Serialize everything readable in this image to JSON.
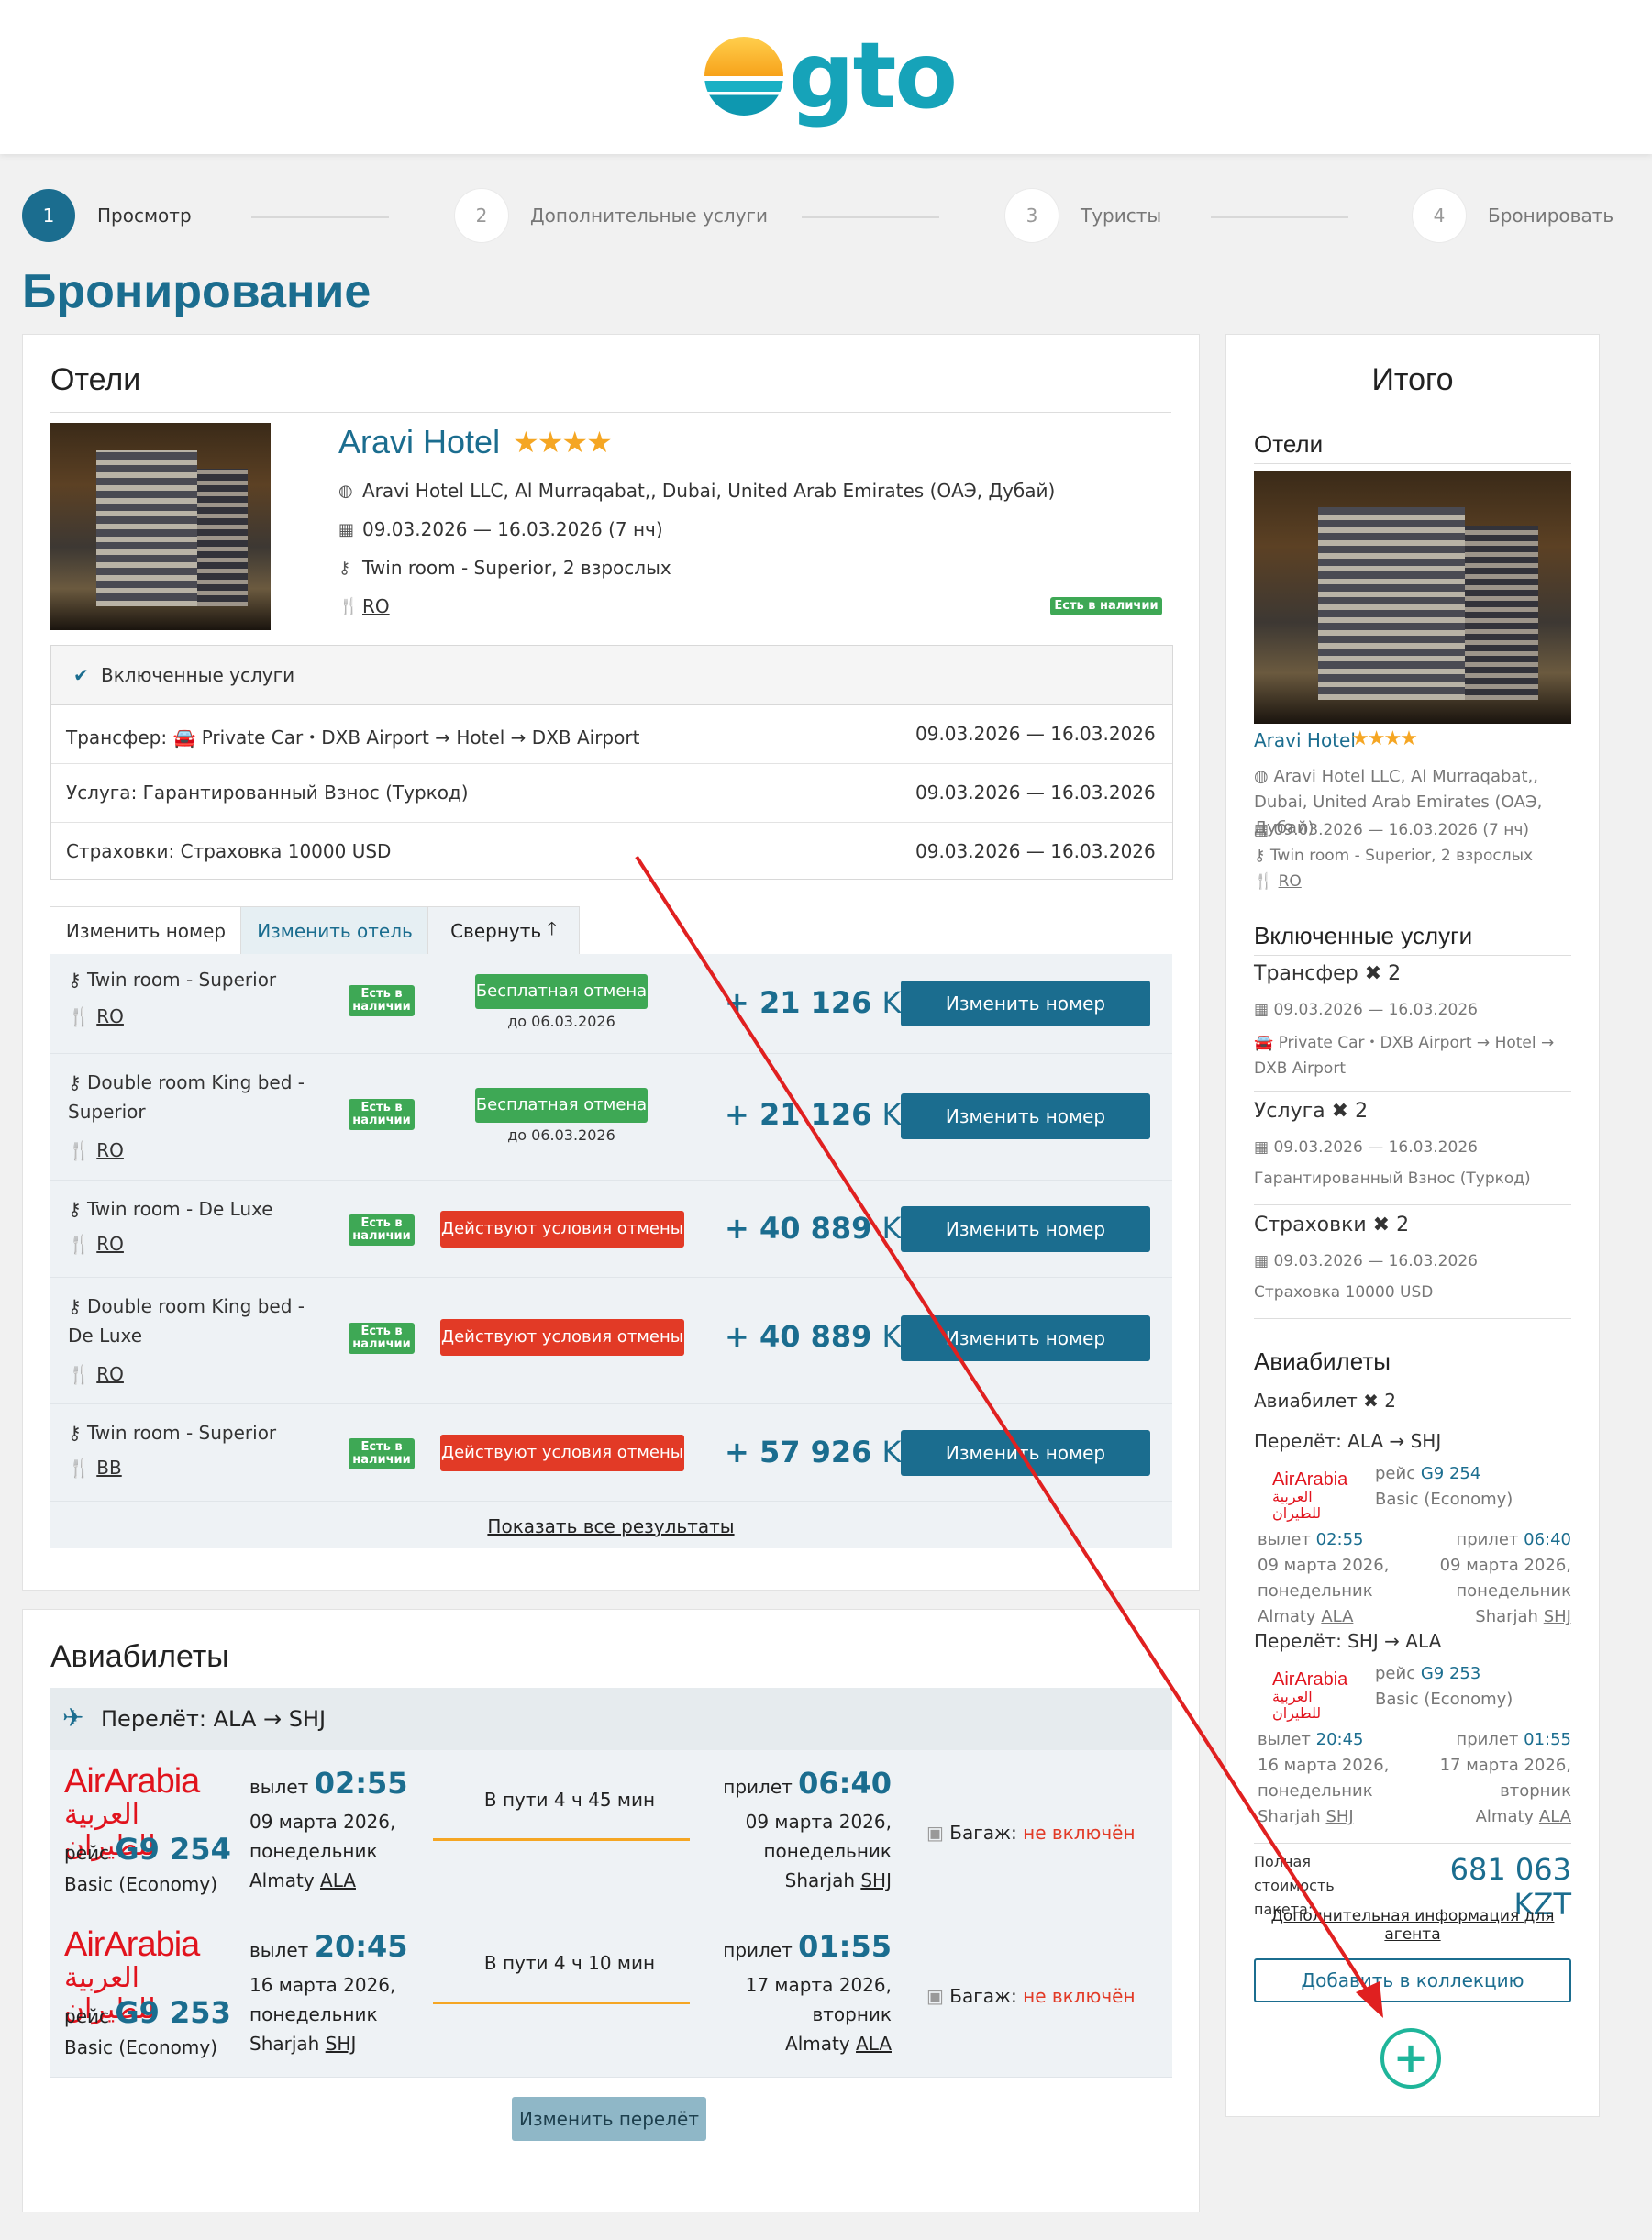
{
  "brand": {
    "logo_text": "gto"
  },
  "steps": [
    {
      "num": "1",
      "label": "Просмотр"
    },
    {
      "num": "2",
      "label": "Дополнительные услуги"
    },
    {
      "num": "3",
      "label": "Туристы"
    },
    {
      "num": "4",
      "label": "Бронировать"
    }
  ],
  "page_title": "Бронирование",
  "hotels": {
    "section_title": "Отели",
    "hotel_name": "Aravi Hotel",
    "stars": "★★★★",
    "address": "Aravi Hotel LLC, Al Murraqabat,, Dubai, United Arab Emirates (ОАЭ, Дубай)",
    "dates": "09.03.2026 —  16.03.2026 (7 нч)",
    "room": "Twin room - Superior, 2 взрослых",
    "board": "RO",
    "availability": "Есть в наличии",
    "included": {
      "title": "Включенные услуги",
      "rows": [
        {
          "label": "Трансфер:",
          "detail": "Private Car・DXB Airport → Hotel → DXB Airport",
          "dates": "09.03.2026 —  16.03.2026"
        },
        {
          "label": "Услуга:",
          "detail": "Гарантированный Взнос (Туркод)",
          "dates": "09.03.2026 —  16.03.2026"
        },
        {
          "label": "Страховки:",
          "detail": "Страховка 10000 USD",
          "dates": "09.03.2026 —  16.03.2026"
        }
      ]
    },
    "tabs": {
      "change_room": "Изменить номер",
      "change_hotel": "Изменить отель",
      "collapse": "Свернуть"
    },
    "rooms": [
      {
        "name": "Twin room - Superior",
        "board": "RO",
        "avail": "Есть в наличии",
        "policy": "Бесплатная отмена",
        "policy_sub": "до 06.03.2026",
        "price": "+ 21 126",
        "currency": "KZT",
        "button": "Изменить номер"
      },
      {
        "name": "Double room King bed - Superior",
        "board": "RO",
        "avail": "Есть в наличии",
        "policy": "Бесплатная отмена",
        "policy_sub": "до 06.03.2026",
        "price": "+ 21 126",
        "currency": "KZT",
        "button": "Изменить номер"
      },
      {
        "name": "Twin room - De Luxe",
        "board": "RO",
        "avail": "Есть в наличии",
        "policy": "Действуют условия отмены",
        "policy_sub": "",
        "price": "+ 40 889",
        "currency": "KZT",
        "button": "Изменить номер"
      },
      {
        "name": "Double room King bed - De Luxe",
        "board": "RO",
        "avail": "Есть в наличии",
        "policy": "Действуют условия отмены",
        "policy_sub": "",
        "price": "+ 40 889",
        "currency": "KZT",
        "button": "Изменить номер"
      },
      {
        "name": "Twin room - Superior",
        "board": "BB",
        "avail": "Есть в наличии",
        "policy": "Действуют условия отмены",
        "policy_sub": "",
        "price": "+ 57 926",
        "currency": "KZT",
        "button": "Изменить номер"
      }
    ],
    "show_all": "Показать все результаты"
  },
  "flights": {
    "section_title": "Авиабилеты",
    "route_title": "Перелёт: ALA → SHJ",
    "airline_en": "AirArabia",
    "airline_ar": "العربية للطيران",
    "legs": [
      {
        "flight_label": "рейс",
        "flight_no": "G9 254",
        "class": "Basic (Economy)",
        "dep_label": "вылет",
        "dep_time": "02:55",
        "dep_date": "09 марта 2026,",
        "dep_day": "понедельник",
        "dep_city": "Almaty",
        "dep_code": "ALA",
        "duration": "В пути 4 ч 45 мин",
        "arr_label": "прилет",
        "arr_time": "06:40",
        "arr_date": "09 марта 2026,",
        "arr_day": "понедельник",
        "arr_city": "Sharjah",
        "arr_code": "SHJ",
        "baggage_label": "Багаж:",
        "baggage": "не включён"
      },
      {
        "flight_label": "рейс",
        "flight_no": "G9 253",
        "class": "Basic (Economy)",
        "dep_label": "вылет",
        "dep_time": "20:45",
        "dep_date": "16 марта 2026,",
        "dep_day": "понедельник",
        "dep_city": "Sharjah",
        "dep_code": "SHJ",
        "duration": "В пути 4 ч 10 мин",
        "arr_label": "прилет",
        "arr_time": "01:55",
        "arr_date": "17 марта 2026,",
        "arr_day": "вторник",
        "arr_city": "Almaty",
        "arr_code": "ALA",
        "baggage_label": "Багаж:",
        "baggage": "не включён"
      }
    ],
    "change_button": "Изменить перелёт"
  },
  "summary": {
    "title": "Итого",
    "hotels_title": "Отели",
    "hotel_name": "Aravi Hotel",
    "stars": "★★★★",
    "address": "Aravi Hotel LLC, Al Murraqabat,, Dubai, United Arab Emirates (ОАЭ, Дубай)",
    "dates": "09.03.2026 —  16.03.2026 (7 нч)",
    "room": "Twin room - Superior, 2 взрослых",
    "board": "RO",
    "included_title": "Включенные услуги",
    "transfer": {
      "label": "Трансфер",
      "count": "2",
      "dates": "09.03.2026 —  16.03.2026",
      "detail": "Private Car・DXB Airport → Hotel → DXB Airport"
    },
    "service": {
      "label": "Услуга",
      "count": "2",
      "dates": "09.03.2026 —  16.03.2026",
      "detail": "Гарантированный Взнос (Туркод)"
    },
    "insurance": {
      "label": "Страховки",
      "count": "2",
      "dates": "09.03.2026 —  16.03.2026",
      "detail": "Страховка 10000 USD"
    },
    "flights_title": "Авиабилеты",
    "flights_label": "Авиабилет",
    "flights_count": "2",
    "legs": [
      {
        "route": "Перелёт: ALA → SHJ",
        "flight_label": "рейс",
        "flight_no": "G9 254",
        "class": "Basic (Economy)",
        "dep_label": "вылет",
        "dep_time": "02:55",
        "dep_date": "09 марта 2026,",
        "dep_day": "понедельник",
        "dep_city": "Almaty",
        "dep_code": "ALA",
        "arr_label": "прилет",
        "arr_time": "06:40",
        "arr_date": "09 марта 2026,",
        "arr_day": "понедельник",
        "arr_city": "Sharjah",
        "arr_code": "SHJ"
      },
      {
        "route": "Перелёт: SHJ → ALA",
        "flight_label": "рейс",
        "flight_no": "G9 253",
        "class": "Basic (Economy)",
        "dep_label": "вылет",
        "dep_time": "20:45",
        "dep_date": "16 марта 2026,",
        "dep_day": "понедельник",
        "dep_city": "Sharjah",
        "dep_code": "SHJ",
        "arr_label": "прилет",
        "arr_time": "01:55",
        "arr_date": "17 марта 2026,",
        "arr_day": "вторник",
        "arr_city": "Almaty",
        "arr_code": "ALA"
      }
    ],
    "total_label": "Полная стоимость пакета:",
    "total_price": "681 063 KZT",
    "agent_info": "Дополнительная информация для агента",
    "add_collection": "Добавить в коллекцию",
    "add_icon": "plus-circle-icon"
  },
  "colors": {
    "primary": "#1b6d8f",
    "green": "#3ea855",
    "red": "#e23a26",
    "accent": "#f5a623",
    "teal": "#1fb59a",
    "arrow": "#e02020"
  }
}
